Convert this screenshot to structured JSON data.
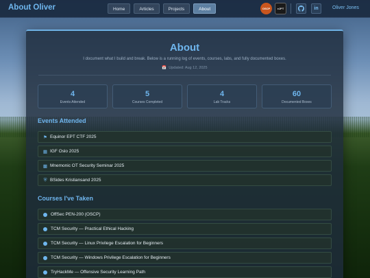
{
  "nav": {
    "brand": "About Oliver",
    "links": [
      "Home",
      "Articles",
      "Projects",
      "About"
    ],
    "badge_a": "OSCP",
    "badge_b": "eJPT",
    "owner_name": "Oliver Jones"
  },
  "page": {
    "title": "About",
    "intro": "I document what I build and break. Below is a running log of events, courses, labs, and fully documented boxes.",
    "updated": "Updated: Aug 12, 2025"
  },
  "stats": [
    {
      "value": "4",
      "label": "Events Attended"
    },
    {
      "value": "5",
      "label": "Courses Completed"
    },
    {
      "value": "4",
      "label": "Lab Tracks"
    },
    {
      "value": "60",
      "label": "Documented Boxes"
    }
  ],
  "events": {
    "title": "Events Attended",
    "items": [
      {
        "icon": "flag-icon",
        "label": "Equinor EPT CTF 2025"
      },
      {
        "icon": "building-icon",
        "label": "IGF Oslo 2025"
      },
      {
        "icon": "factory-icon",
        "label": "Mnemonic OT Security Seminar 2025"
      },
      {
        "icon": "shield-icon",
        "label": "BSides Kristiansand 2025"
      }
    ]
  },
  "courses": {
    "title": "Courses I've Taken",
    "items": [
      "OffSec PEN-200 (OSCP)",
      "TCM Security — Practical Ethical Hacking",
      "TCM Security — Linux Privilege Escalation for Beginners",
      "TCM Security — Windows Privilege Escalation for Beginners",
      "TryHackMe — Offensive Security Learning Path"
    ]
  },
  "colors": {
    "accent": "#6fb6ee",
    "navbar": "#1a2a40",
    "card": "#1e2c3c"
  }
}
